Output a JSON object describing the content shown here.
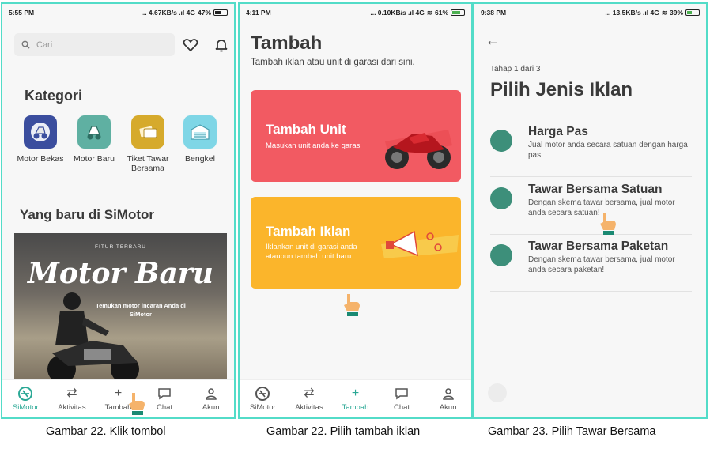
{
  "screen1": {
    "status": {
      "time": "5:55 PM",
      "right": "... 4.67KB/s .ıl 4G",
      "battery": "47%"
    },
    "search_placeholder": "Cari",
    "kategori_title": "Kategori",
    "categories": [
      {
        "label": "Motor Bekas",
        "color": "#3b4e9e"
      },
      {
        "label": "Motor Baru",
        "color": "#5fb0a2"
      },
      {
        "label": "Tiket Tawar Bersama",
        "color": "#d6aa2c"
      },
      {
        "label": "Bengkel",
        "color": "#7fd6e6"
      }
    ],
    "baru_title": "Yang baru di SiMotor",
    "banner": {
      "fitur": "FITUR TERBARU",
      "big": "Motor Baru",
      "sub": "Temukan motor incaran Anda di SiMotor"
    },
    "nav": [
      "SiMotor",
      "Aktivitas",
      "Tambah",
      "Chat",
      "Akun"
    ]
  },
  "screen2": {
    "status": {
      "time": "4:11 PM",
      "right": "... 0.10KB/s .ıl 4G",
      "battery": "61%"
    },
    "title": "Tambah",
    "subtitle": "Tambah iklan atau unit di garasi dari sini.",
    "card_unit": {
      "title": "Tambah Unit",
      "desc": "Masukan unit anda ke garasi"
    },
    "card_iklan": {
      "title": "Tambah Iklan",
      "desc": "Iklankan unit di garasi anda ataupun tambah unit baru"
    },
    "nav": [
      "SiMotor",
      "Aktivitas",
      "Tambah",
      "Chat",
      "Akun"
    ]
  },
  "screen3": {
    "status": {
      "time": "9:38 PM",
      "right": "... 13.5KB/s .ıl 4G",
      "battery": "39%"
    },
    "step": "Tahap 1 dari 3",
    "title": "Pilih Jenis Iklan",
    "options": [
      {
        "title": "Harga Pas",
        "desc": "Jual motor anda secara satuan dengan harga pas!"
      },
      {
        "title": "Tawar Bersama Satuan",
        "desc": "Dengan skema tawar bersama, jual motor anda secara satuan!"
      },
      {
        "title": "Tawar Bersama Paketan",
        "desc": "Dengan skema tawar bersama, jual motor anda secara paketan!"
      }
    ]
  },
  "captions": [
    "Gambar 22. Klik tombol",
    "Gambar 22. Pilih tambah iklan",
    "Gambar 23. Pilih Tawar Bersama"
  ],
  "colors": {
    "teal": "#2aa895",
    "frame": "#53dcc8",
    "red_card": "#f25a62",
    "orange_card": "#fbb52b"
  }
}
